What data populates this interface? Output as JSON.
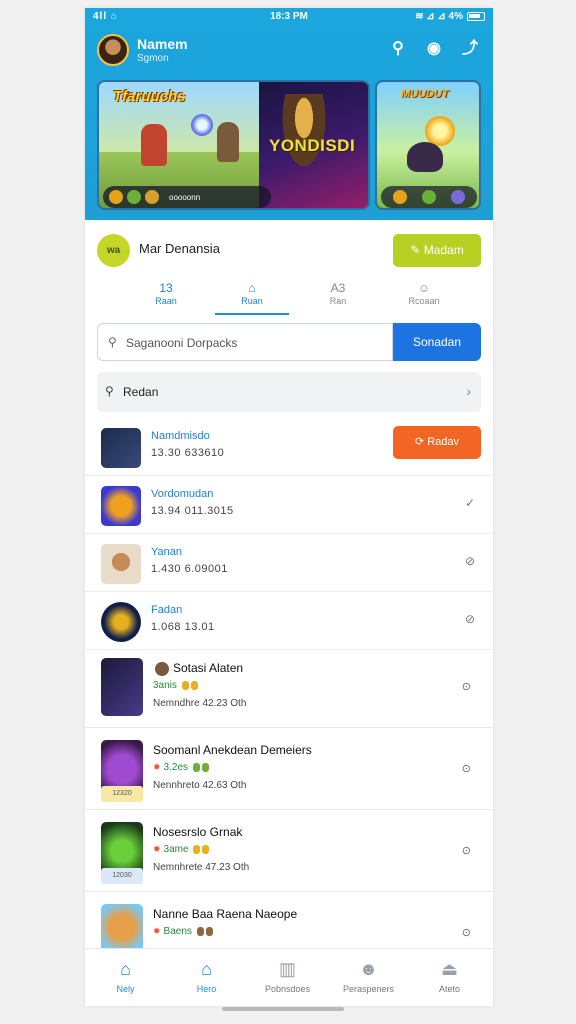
{
  "status": {
    "left": "4ll ⌂",
    "time": "18:3 PM",
    "right": "≋ ⊿ ⊿ 4%"
  },
  "user": {
    "name": "Namem",
    "subtitle": "Sgmon"
  },
  "banners": [
    {
      "title": "Tfaruuchs",
      "center_text": "YONDISDI",
      "bar_text": "ooooonn"
    },
    {
      "title": "MUUDUT"
    }
  ],
  "profile": {
    "logo": "wa",
    "name": "Mar Denansia",
    "button": "Madam"
  },
  "tabs": [
    {
      "icon": "13",
      "label": "Raan"
    },
    {
      "icon": "⌂",
      "label": "Ruan"
    },
    {
      "icon": "A3",
      "label": "Ran"
    },
    {
      "icon": "☺",
      "label": "Rcoaan"
    }
  ],
  "search": {
    "placeholder": "Saganooni Dorpacks",
    "button": "Sonadan"
  },
  "filter": {
    "label": "Redan"
  },
  "list": [
    {
      "title": "Namdmisdo",
      "meta": "13.30 633610",
      "action": "Radav"
    },
    {
      "title": "Vordomudan",
      "meta": "13.94 011.3015"
    },
    {
      "title": "Yanan",
      "meta": "1.430 6.09001"
    },
    {
      "title": "Fadan",
      "meta": "1.068 13.01"
    }
  ],
  "cards": [
    {
      "title": "Sotasi Alaten",
      "stars": "3anis",
      "meta": "Nemndhre 42.23 Oth",
      "tag": ""
    },
    {
      "title": "Soomanl Anekdean Demeiers",
      "stars": "3.2es",
      "meta": "Nennhreto 42.63 Oth",
      "tag": "12320"
    },
    {
      "title": "Nosesrslo Grnak",
      "stars": "3ame",
      "meta": "Nemnhrete 47.23 Oth",
      "tag": "12030"
    },
    {
      "title": "Nanne Baa Raena Naeope",
      "stars": "Baens",
      "meta": "",
      "tag": ""
    }
  ],
  "bottom_nav": [
    {
      "label": "Nely",
      "icon": "home-icon"
    },
    {
      "label": "Hero",
      "icon": "home-outline-icon"
    },
    {
      "label": "Pobnsdoes",
      "icon": "book-icon"
    },
    {
      "label": "Peraspeners",
      "icon": "user-icon"
    },
    {
      "label": "Ateto",
      "icon": "lock-icon"
    }
  ],
  "colors": {
    "header": "#1ba6de",
    "accent_lime": "#b8cf24",
    "search_button": "#1d73e0",
    "action_orange": "#f26522",
    "link_blue": "#1f7fd1"
  }
}
